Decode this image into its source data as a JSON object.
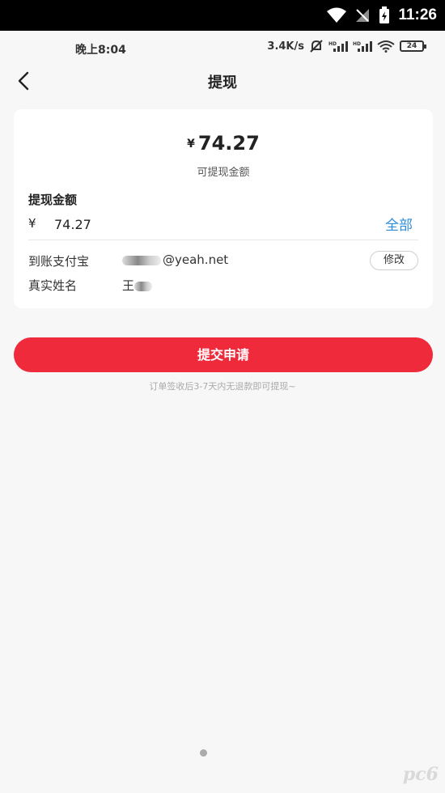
{
  "system_bar": {
    "time": "11:26"
  },
  "phone_status": {
    "time": "晚上8:04",
    "speed": "3.4K/s",
    "battery": "24"
  },
  "nav": {
    "title": "提现"
  },
  "card": {
    "currency": "¥",
    "amount": "74.27",
    "amount_label": "可提现金额",
    "section_title": "提现金额",
    "input_currency": "¥",
    "input_value": "74.27",
    "all_label": "全部",
    "account_label": "到账支付宝",
    "account_value": "@yeah.net",
    "edit_label": "修改",
    "name_label": "真实姓名",
    "name_value": "王"
  },
  "submit_label": "提交申请",
  "hint": "订单签收后3-7天内无退款即可提现~",
  "watermark": "pc6",
  "colors": {
    "primary": "#ee2a3b",
    "link": "#2d8cd8"
  }
}
